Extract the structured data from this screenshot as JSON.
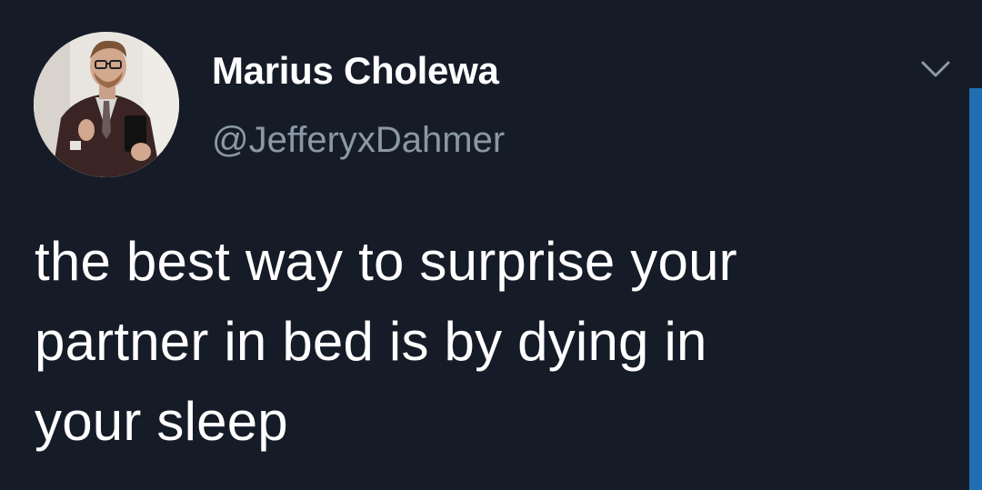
{
  "tweet": {
    "display_name": "Marius Cholewa",
    "handle": "@JefferyxDahmer",
    "text_lines": [
      "the best way to surprise your",
      "partner in bed is by dying in",
      "your sleep"
    ]
  },
  "icons": {
    "avatar": "user-avatar-photo",
    "menu": "chevron-down-icon"
  },
  "colors": {
    "background": "#161c27",
    "name": "#ffffff",
    "handle": "#8b98a5",
    "text": "#ffffff",
    "scrollbar": "#1f6fb2"
  }
}
